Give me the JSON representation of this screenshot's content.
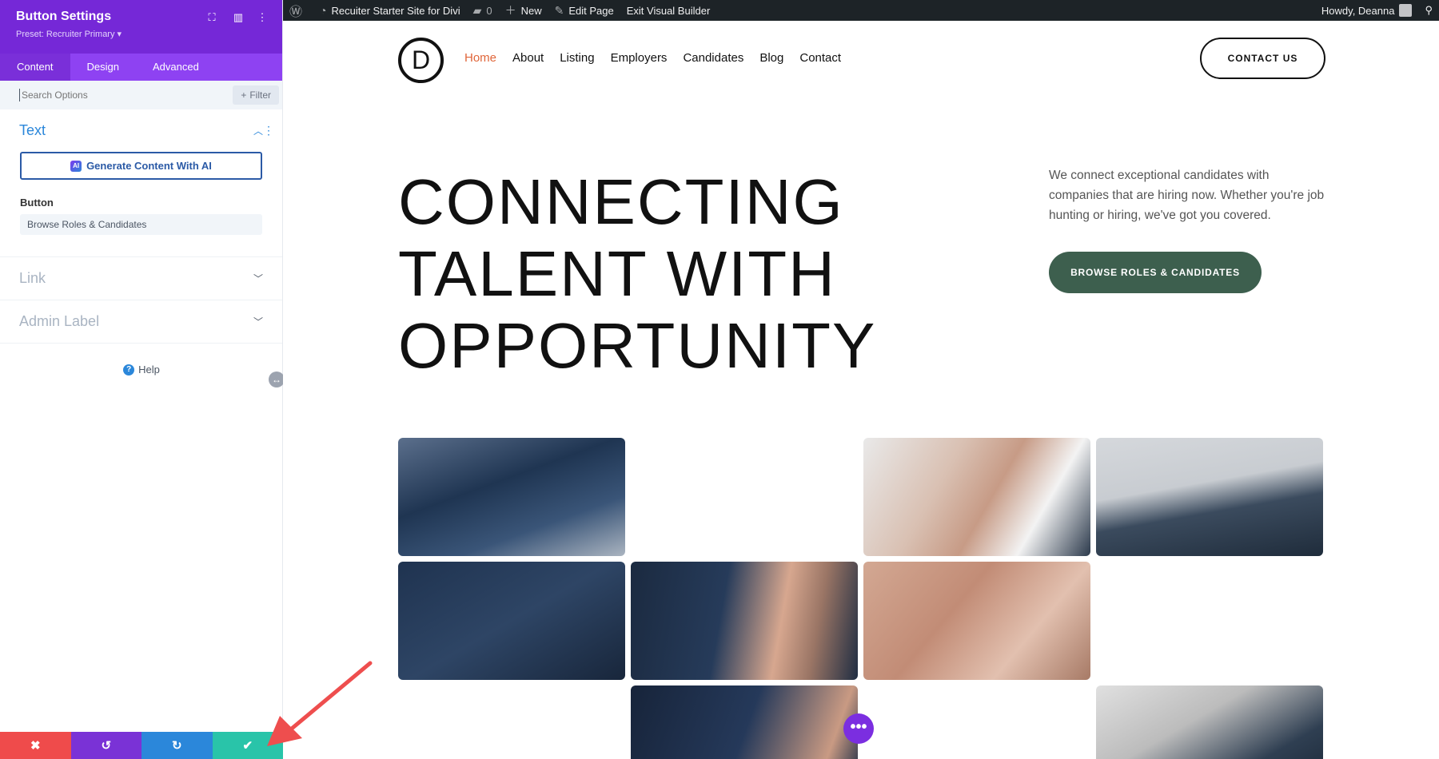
{
  "admin_bar": {
    "site_name": "Recuiter Starter Site for Divi",
    "comments_count": "0",
    "new_label": "New",
    "edit_page_label": "Edit Page",
    "exit_builder_label": "Exit Visual Builder",
    "howdy": "Howdy, Deanna"
  },
  "panel": {
    "title": "Button Settings",
    "preset": "Preset: Recruiter Primary ▾",
    "tabs": [
      "Content",
      "Design",
      "Advanced"
    ],
    "search_placeholder": "Search Options",
    "filter_label": "Filter",
    "text_section": {
      "title": "Text",
      "ai_button": "Generate Content With AI",
      "ai_icon": "AI",
      "button_label": "Button",
      "button_value": "Browse Roles & Candidates"
    },
    "link_section": {
      "title": "Link"
    },
    "admin_label_section": {
      "title": "Admin Label"
    },
    "help_label": "Help",
    "colors": {
      "header": "#7528d7",
      "tabs": "#8e42f2",
      "accent": "#2b87da"
    }
  },
  "footer_buttons": [
    {
      "name": "discard",
      "color": "#ef4b4b"
    },
    {
      "name": "undo",
      "color": "#7a32d6"
    },
    {
      "name": "redo",
      "color": "#2b87da"
    },
    {
      "name": "save",
      "color": "#29c4a9"
    }
  ],
  "site": {
    "logo_letter": "D",
    "nav": [
      "Home",
      "About",
      "Listing",
      "Employers",
      "Candidates",
      "Blog",
      "Contact"
    ],
    "active_nav": "Home",
    "contact_button": "CONTACT US",
    "hero_lines": [
      "CONNECTING",
      "TALENT WITH",
      "OPPORTUNITY"
    ],
    "hero_description": "We connect exceptional candidates with companies that are hiring now. Whether you're job hunting or hiring, we've got you covered.",
    "browse_button": "BROWSE ROLES & CANDIDATES",
    "fab_label": "•••",
    "colors": {
      "active_nav": "#e0663a",
      "browse_button": "#3d5f4e",
      "fab": "#7b2ee0"
    }
  }
}
